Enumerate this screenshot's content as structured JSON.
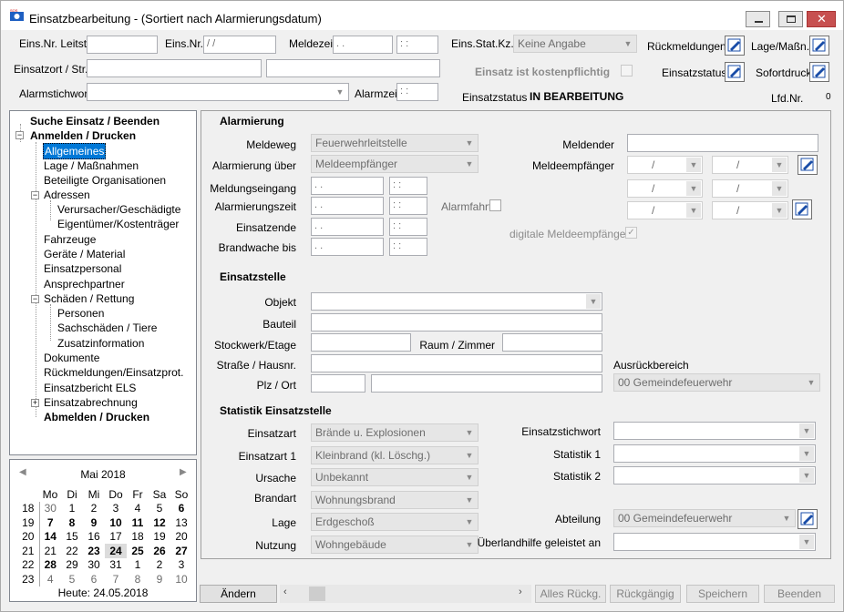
{
  "window": {
    "title": "Einsatzbearbeitung - (Sortiert nach Alarmierungsdatum)"
  },
  "header": {
    "leitst_label": "Eins.Nr. Leitst.",
    "leitst_value": "",
    "einsnr_label": "Eins.Nr.",
    "einsnr_value": "/ /",
    "meldezeit_label": "Meldezeit",
    "meldezeit_date": ". .",
    "meldezeit_time": ": :",
    "statkz_label": "Eins.Stat.Kz.",
    "statkz_value": "Keine Angabe",
    "rueckmeldungen_label": "Rückmeldungen",
    "lage_label": "Lage/Maßn.",
    "einsatzort_label": "Einsatzort / Str.",
    "einsatzort_value": "",
    "einsatzort_value2": "",
    "kosten_label": "Einsatz ist kostenpflichtig",
    "einsatzstatus_btn_label": "Einsatzstatus",
    "sofortdruck_label": "Sofortdruck",
    "alarmstichwort_label": "Alarmstichwort",
    "alarmstichwort_value": "",
    "alarmzeit_label": "Alarmzeit",
    "alarmzeit_value": ": :",
    "status_label": "Einsatzstatus",
    "status_value": "IN BEARBEITUNG",
    "lfdnr_label": "Lfd.Nr.",
    "lfdnr_value": "0"
  },
  "tree": {
    "suche": "Suche Einsatz / Beenden",
    "anmelden": "Anmelden / Drucken",
    "allgemeines": "Allgemeines",
    "lage": "Lage / Maßnahmen",
    "beteiligte": "Beteiligte Organisationen",
    "adressen": "Adressen",
    "verursacher": "Verursacher/Geschädigte",
    "eigentuemer": "Eigentümer/Kostenträger",
    "fahrzeuge": "Fahrzeuge",
    "geraete": "Geräte / Material",
    "personal": "Einsatzpersonal",
    "ansprech": "Ansprechpartner",
    "schaeden": "Schäden / Rettung",
    "personen": "Personen",
    "sachschaeden": "Sachschäden / Tiere",
    "zusatz": "Zusatzinformation",
    "dokumente": "Dokumente",
    "rueck": "Rückmeldungen/Einsatzprot.",
    "els": "Einsatzbericht ELS",
    "abrechnung": "Einsatzabrechnung",
    "abmelden": "Abmelden / Drucken"
  },
  "calendar": {
    "month": "Mai 2018",
    "days": [
      "Mo",
      "Di",
      "Mi",
      "Do",
      "Fr",
      "Sa",
      "So"
    ],
    "rows": [
      {
        "w": "18",
        "d": [
          "30",
          "1",
          "2",
          "3",
          "4",
          "5",
          "6"
        ]
      },
      {
        "w": "19",
        "d": [
          "7",
          "8",
          "9",
          "10",
          "11",
          "12",
          "13"
        ]
      },
      {
        "w": "20",
        "d": [
          "14",
          "15",
          "16",
          "17",
          "18",
          "19",
          "20"
        ]
      },
      {
        "w": "21",
        "d": [
          "21",
          "22",
          "23",
          "24",
          "25",
          "26",
          "27"
        ]
      },
      {
        "w": "22",
        "d": [
          "28",
          "29",
          "30",
          "31",
          "1",
          "2",
          "3"
        ]
      },
      {
        "w": "23",
        "d": [
          "4",
          "5",
          "6",
          "7",
          "8",
          "9",
          "10"
        ]
      }
    ],
    "today": "Heute: 24.05.2018"
  },
  "alarm": {
    "title": "Alarmierung",
    "meldeweg_label": "Meldeweg",
    "meldeweg_value": "Feuerwehrleitstelle",
    "ueber_label": "Alarmierung über",
    "ueber_value": "Meldeempfänger",
    "eingang_label": "Meldungseingang",
    "alarmzeit_label": "Alarmierungszeit",
    "ende_label": "Einsatzende",
    "brandwache_label": "Brandwache bis",
    "date_ph": ". .",
    "time_ph": ": :",
    "alarmfahrt_label": "Alarmfahrt",
    "meldender_label": "Meldender",
    "meldeempf_label": "Meldeempfänger",
    "slash": "/",
    "digital_label": "digitale Meldeempfänger"
  },
  "stelle": {
    "title": "Einsatzstelle",
    "objekt_label": "Objekt",
    "bauteil_label": "Bauteil",
    "stockwerk_label": "Stockwerk/Etage",
    "raum_label": "Raum / Zimmer",
    "strasse_label": "Straße / Hausnr.",
    "plz_label": "Plz / Ort",
    "ausrueck_label": "Ausrückbereich",
    "ausrueck_value": "00 Gemeindefeuerwehr"
  },
  "statistik": {
    "title": "Statistik Einsatzstelle",
    "art_label": "Einsatzart",
    "art_value": "Brände u. Explosionen",
    "art1_label": "Einsatzart 1",
    "art1_value": "Kleinbrand (kl. Löschg.)",
    "ursache_label": "Ursache",
    "ursache_value": "Unbekannt",
    "brandart_label": "Brandart",
    "brandart_value": "Wohnungsbrand",
    "lage_label": "Lage",
    "lage_value": "Erdgeschoß",
    "nutzung_label": "Nutzung",
    "nutzung_value": "Wohngebäude",
    "stichwort_label": "Einsatzstichwort",
    "stat1_label": "Statistik 1",
    "stat2_label": "Statistik 2",
    "abteilung_label": "Abteilung",
    "abteilung_value": "00 Gemeindefeuerwehr",
    "ueberland_label": "Überlandhilfe geleistet an"
  },
  "footer": {
    "aendern": "Ändern",
    "alles": "Alles Rückg.",
    "rueckgaengig": "Rückgängig",
    "speichern": "Speichern",
    "beenden": "Beenden"
  }
}
